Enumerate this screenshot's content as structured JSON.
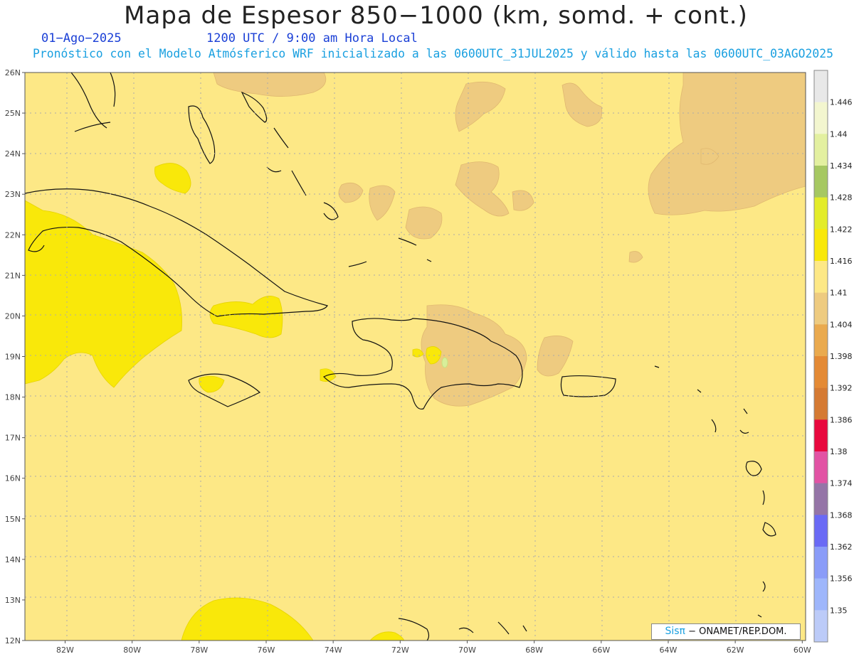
{
  "title": "Mapa de Espesor 850−1000 (km, somd. + cont.)",
  "date": "01−Ago−2025",
  "time": "1200 UTC / 9:00 am Hora Local",
  "forecast_line": "Pronóstico con el Modelo Atmósferico WRF inicializado a las 0600UTC_31JUL2025 y válido hasta las  0600UTC_03AGO2025",
  "credit": {
    "brand": "Sisπ",
    "text": "− ONAMET/REP.DOM."
  },
  "axes": {
    "lat_labels": [
      "26N",
      "25N",
      "24N",
      "23N",
      "22N",
      "21N",
      "20N",
      "19N",
      "18N",
      "17N",
      "16N",
      "15N",
      "14N",
      "13N",
      "12N"
    ],
    "lon_labels": [
      "82W",
      "80W",
      "78W",
      "76W",
      "74W",
      "72W",
      "70W",
      "68W",
      "66W",
      "64W",
      "62W",
      "60W"
    ],
    "lat_range": [
      12,
      26
    ],
    "lon_range": [
      -83.2,
      -59.9
    ],
    "grid": true
  },
  "legend": {
    "labels": [
      "1.446",
      "1.44",
      "1.434",
      "1.428",
      "1.422",
      "1.416",
      "1.41",
      "1.404",
      "1.398",
      "1.392",
      "1.386",
      "1.38",
      "1.374",
      "1.368",
      "1.362",
      "1.356",
      "1.35"
    ],
    "colors": [
      "#e8e8e8",
      "#f3f6cf",
      "#e3f0a0",
      "#a6c862",
      "#e3ec2a",
      "#f9e80a",
      "#fde886",
      "#eecb80",
      "#eaaa4e",
      "#e48a35",
      "#d57a33",
      "#e8083e",
      "#e253a4",
      "#9575a7",
      "#6a6af5",
      "#8a9cf8",
      "#9eb6fb",
      "#bccbf8"
    ]
  },
  "colors": {
    "background_field": "#fde886",
    "lower_band": "#eecb80",
    "higher_band": "#f9e80a"
  }
}
